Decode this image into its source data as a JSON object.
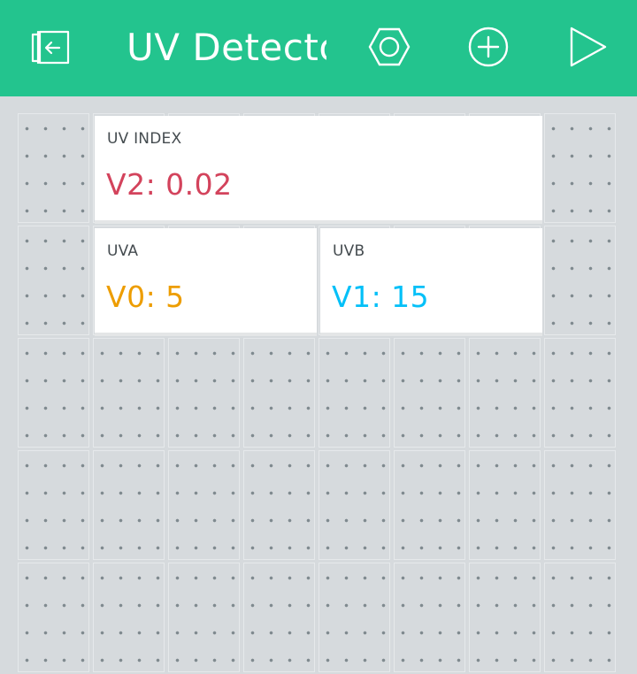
{
  "header": {
    "title": "UV Detector",
    "background_color": "#23c48e",
    "icons": [
      "exit-icon",
      "settings-nut-icon",
      "add-widget-icon",
      "play-icon"
    ]
  },
  "widgets": [
    {
      "label": "UV INDEX",
      "value": "V2: 0.02",
      "color": "#d3435c"
    },
    {
      "label": "UVA",
      "value": "V0: 5",
      "color": "#ed9d00"
    },
    {
      "label": "UVB",
      "value": "V1: 15",
      "color": "#04c0f8"
    }
  ]
}
